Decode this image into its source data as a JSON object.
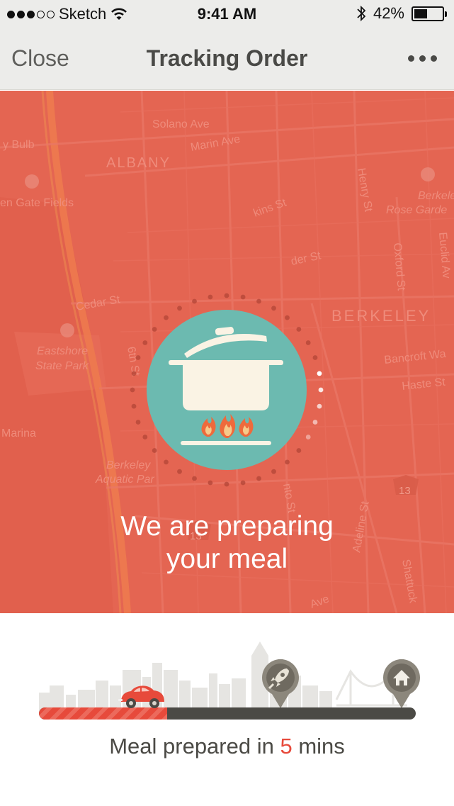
{
  "status_bar": {
    "carrier": "Sketch",
    "time": "9:41 AM",
    "battery_percent": "42%",
    "battery_level": 0.42,
    "signal_bars_filled": 3,
    "signal_bars_total": 5
  },
  "nav": {
    "close_label": "Close",
    "title": "Tracking Order",
    "more_icon": "ellipsis-icon"
  },
  "map": {
    "labels": [
      "Solano Ave",
      "Marin Ave",
      "ALBANY",
      "y Bulb",
      "en Gate Fields",
      "Cedar St",
      "6th St",
      "Eastshore",
      "State Park",
      "Marina",
      "Berkeley",
      "Aquatic Par",
      "BERKELEY",
      "Henry St",
      "Berkeley",
      "Rose Garde",
      "Oxford St",
      "Euclid Av",
      "Bancroft Wa",
      "Haste St",
      "Adeline St",
      "Shattuck",
      "13",
      "13",
      "Ave",
      "der St",
      "kins St",
      "nto St"
    ]
  },
  "status": {
    "icon": "cooking-pot-icon",
    "message_line1": "We are preparing",
    "message_line2": "your meal",
    "progress_dots_lit": 5
  },
  "tracker": {
    "progress_fraction": 0.34,
    "car_icon": "car-icon",
    "restaurant_icon": "rocket-pin-icon",
    "home_icon": "home-pin-icon",
    "eta_prefix": "Meal prepared in",
    "eta_value": "5",
    "eta_suffix": "mins"
  },
  "colors": {
    "accent_red": "#e46552",
    "teal": "#6cbab0",
    "progress_red": "#e74a3b",
    "dark_track": "#4b4a45"
  }
}
